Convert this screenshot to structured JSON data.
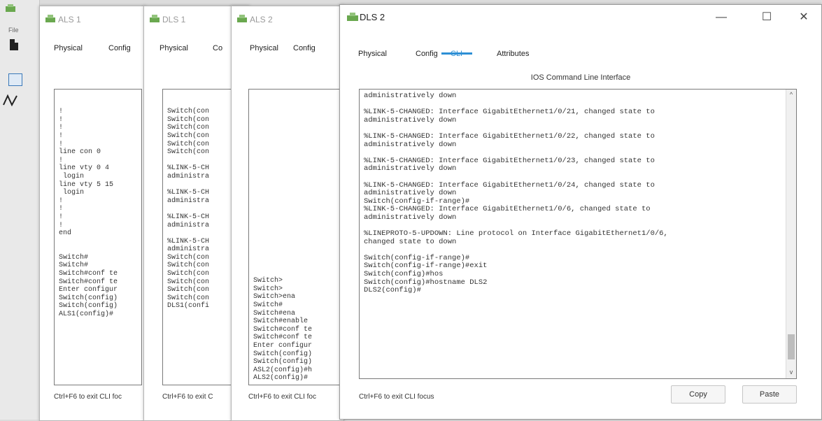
{
  "toolbar": {
    "file_label": "File"
  },
  "windows": {
    "als1": {
      "title": "ALS 1",
      "tabs": [
        "Physical",
        "Config"
      ],
      "lines": [
        "!",
        "!",
        "!",
        "!",
        "!",
        "line con 0",
        "!",
        "line vty 0 4",
        " login",
        "line vty 5 15",
        " login",
        "!",
        "!",
        "!",
        "!",
        "end",
        "",
        "",
        "Switch#",
        "Switch#",
        "Switch#conf te",
        "Switch#conf te",
        "Enter configur",
        "Switch(config)",
        "Switch(config)",
        "ALS1(config)#"
      ],
      "status": "Ctrl+F6 to exit CLI foc"
    },
    "dls1": {
      "title": "DLS 1",
      "tabs": [
        "Physical",
        "Co"
      ],
      "lines": [
        "Switch(con",
        "Switch(con",
        "Switch(con",
        "Switch(con",
        "Switch(con",
        "Switch(con",
        "",
        "%LINK-5-CH",
        "administra",
        "",
        "%LINK-5-CH",
        "administra",
        "",
        "%LINK-5-CH",
        "administra",
        "",
        "%LINK-5-CH",
        "administra",
        "Switch(con",
        "Switch(con",
        "Switch(con",
        "Switch(con",
        "Switch(con",
        "Switch(con",
        "DLS1(confi"
      ],
      "status": "Ctrl+F6 to exit C"
    },
    "als2": {
      "title": "ALS 2",
      "tabs": [
        "Physical",
        "Config"
      ],
      "lines": [
        "Switch>",
        "Switch>",
        "Switch>ena",
        "Switch#",
        "Switch#ena",
        "Switch#enable",
        "Switch#conf te",
        "Switch#conf te",
        "Enter configur",
        "Switch(config)",
        "Switch(config)",
        "ASL2(config)#h",
        "ALS2(config)#"
      ],
      "status": "Ctrl+F6 to exit CLI foc"
    },
    "dls2": {
      "title": "DLS 2",
      "tabs": [
        "Physical",
        "Config",
        "CLI",
        "Attributes"
      ],
      "header": "IOS Command Line Interface",
      "lines": [
        "administratively down",
        "",
        "%LINK-5-CHANGED: Interface GigabitEthernet1/0/21, changed state to",
        "administratively down",
        "",
        "%LINK-5-CHANGED: Interface GigabitEthernet1/0/22, changed state to",
        "administratively down",
        "",
        "%LINK-5-CHANGED: Interface GigabitEthernet1/0/23, changed state to",
        "administratively down",
        "",
        "%LINK-5-CHANGED: Interface GigabitEthernet1/0/24, changed state to",
        "administratively down",
        "Switch(config-if-range)#",
        "%LINK-5-CHANGED: Interface GigabitEthernet1/0/6, changed state to",
        "administratively down",
        "",
        "%LINEPROTO-5-UPDOWN: Line protocol on Interface GigabitEthernet1/0/6,",
        "changed state to down",
        "",
        "Switch(config-if-range)#",
        "Switch(config-if-range)#exit",
        "Switch(config)#hos",
        "Switch(config)#hostname DLS2",
        "DLS2(config)#"
      ],
      "status": "Ctrl+F6 to exit CLI focus",
      "copy_label": "Copy",
      "paste_label": "Paste",
      "minimize": "—",
      "maximize": "☐",
      "close": "✕"
    }
  }
}
